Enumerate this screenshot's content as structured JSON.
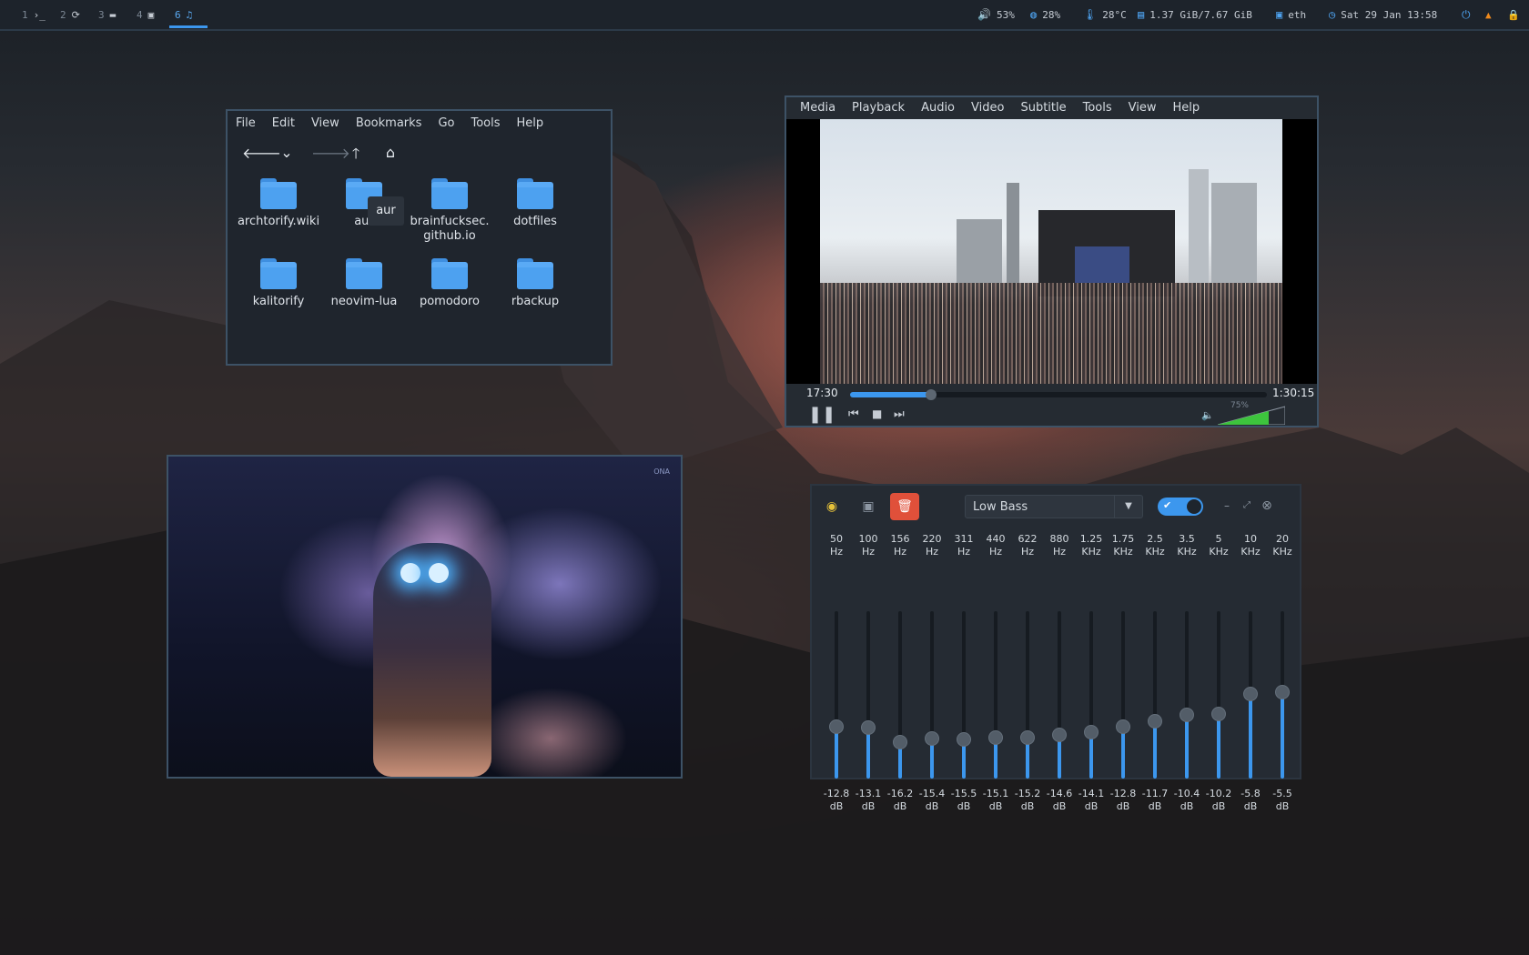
{
  "topbar": {
    "workspaces": [
      {
        "num": "1",
        "icon": "terminal-icon",
        "glyph": "›_"
      },
      {
        "num": "2",
        "icon": "refresh-icon",
        "glyph": "⟳"
      },
      {
        "num": "3",
        "icon": "folder-icon",
        "glyph": "▬"
      },
      {
        "num": "4",
        "icon": "window-icon",
        "glyph": "▣"
      },
      {
        "num": "6",
        "icon": "music-icon",
        "glyph": "♫"
      }
    ],
    "active_workspace": "6",
    "volume": "53%",
    "cpu": "28%",
    "temperature": "28°C",
    "memory": "1.37 GiB/7.67 GiB",
    "network": "eth",
    "datetime": "Sat 29 Jan 13:58"
  },
  "file_manager": {
    "menu": [
      "File",
      "Edit",
      "View",
      "Bookmarks",
      "Go",
      "Tools",
      "Help"
    ],
    "toolbar": {
      "back": "🡐",
      "history": "⌄",
      "forward": "🡒",
      "up": "🡑",
      "home": "⌂"
    },
    "items": [
      "archtorify.wiki",
      "aur",
      "brainfucksec.\ngithub.io",
      "dotfiles",
      "kalitorify",
      "neovim-lua",
      "pomodoro",
      "rbackup"
    ],
    "tooltip": "aur"
  },
  "vlc": {
    "menu": [
      "Media",
      "Playback",
      "Audio",
      "Video",
      "Subtitle",
      "Tools",
      "View",
      "Help"
    ],
    "elapsed": "17:30",
    "duration": "1:30:15",
    "progress": 0.194,
    "volume_label": "75%",
    "volume_level": 0.75
  },
  "equalizer": {
    "preset": "Low Bass",
    "enabled": true,
    "colors": {
      "accent": "#3c97ee",
      "delete": "#e0503a"
    },
    "bands": [
      {
        "freq": "50",
        "unit": "Hz",
        "db": "-12.8",
        "value": -12.8
      },
      {
        "freq": "100",
        "unit": "Hz",
        "db": "-13.1",
        "value": -13.1
      },
      {
        "freq": "156",
        "unit": "Hz",
        "db": "-16.2",
        "value": -16.2
      },
      {
        "freq": "220",
        "unit": "Hz",
        "db": "-15.4",
        "value": -15.4
      },
      {
        "freq": "311",
        "unit": "Hz",
        "db": "-15.5",
        "value": -15.5
      },
      {
        "freq": "440",
        "unit": "Hz",
        "db": "-15.1",
        "value": -15.1
      },
      {
        "freq": "622",
        "unit": "Hz",
        "db": "-15.2",
        "value": -15.2
      },
      {
        "freq": "880",
        "unit": "Hz",
        "db": "-14.6",
        "value": -14.6
      },
      {
        "freq": "1.25",
        "unit": "KHz",
        "db": "-14.1",
        "value": -14.1
      },
      {
        "freq": "1.75",
        "unit": "KHz",
        "db": "-12.8",
        "value": -12.8
      },
      {
        "freq": "2.5",
        "unit": "KHz",
        "db": "-11.7",
        "value": -11.7
      },
      {
        "freq": "3.5",
        "unit": "KHz",
        "db": "-10.4",
        "value": -10.4
      },
      {
        "freq": "5",
        "unit": "KHz",
        "db": "-10.2",
        "value": -10.2
      },
      {
        "freq": "10",
        "unit": "KHz",
        "db": "-5.8",
        "value": -5.8
      },
      {
        "freq": "20",
        "unit": "KHz",
        "db": "-5.5",
        "value": -5.5
      }
    ],
    "db_unit": "dB"
  },
  "image_viewer": {
    "signature": "ONA"
  }
}
